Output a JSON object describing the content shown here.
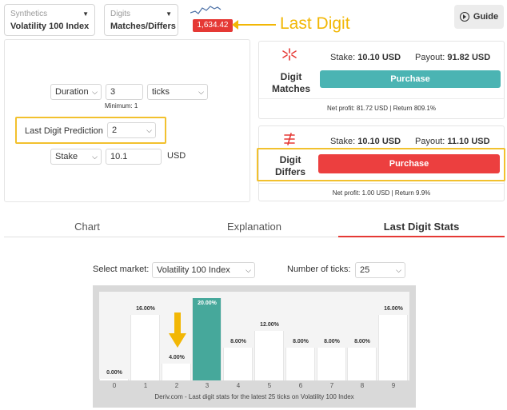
{
  "top": {
    "market_category": "Synthetics",
    "market": "Volatility 100 Index",
    "trade_category": "Digits",
    "trade_type": "Matches/Differs",
    "current_price": "1,634.42",
    "guide_label": "Guide"
  },
  "annotation": {
    "last_digit_label": "Last Digit"
  },
  "params": {
    "duration_label": "Duration",
    "duration_value": "3",
    "duration_unit": "ticks",
    "minimum_note": "Minimum: 1",
    "prediction_label": "Last Digit Prediction",
    "prediction_value": "2",
    "stake_label": "Stake",
    "stake_value": "10.1",
    "currency": "USD"
  },
  "matches": {
    "name_line1": "Digit",
    "name_line2": "Matches",
    "stake_label": "Stake:",
    "stake_value": "10.10 USD",
    "payout_label": "Payout:",
    "payout_value": "91.82 USD",
    "button_label": "Purchase",
    "button_color": "#4bb4b3",
    "footer": "Net profit: 81.72 USD | Return 809.1%"
  },
  "differs": {
    "name_line1": "Digit",
    "name_line2": "Differs",
    "stake_label": "Stake:",
    "stake_value": "10.10 USD",
    "payout_label": "Payout:",
    "payout_value": "11.10 USD",
    "button_label": "Purchase",
    "button_color": "#ec3f3f",
    "footer": "Net profit: 1.00 USD | Return 9.9%"
  },
  "tabs": [
    {
      "label": "Chart",
      "active": false
    },
    {
      "label": "Explanation",
      "active": false
    },
    {
      "label": "Last Digit Stats",
      "active": true
    }
  ],
  "stats": {
    "market_label": "Select market:",
    "market_value": "Volatility 100 Index",
    "ticks_label": "Number of ticks:",
    "ticks_value": "25",
    "caption": "Deriv.com - Last digit stats for the latest 25 ticks on Volatility 100 Index"
  },
  "colors": {
    "accent_red": "#e53935",
    "highlight_yellow": "#f2c12e",
    "bar_active": "#46a89b"
  },
  "chart_data": {
    "type": "bar",
    "categories": [
      "0",
      "1",
      "2",
      "3",
      "4",
      "5",
      "6",
      "7",
      "8",
      "9"
    ],
    "values": [
      0.0,
      16.0,
      4.0,
      20.0,
      8.0,
      12.0,
      8.0,
      8.0,
      8.0,
      16.0
    ],
    "value_labels": [
      "0.00%",
      "16.00%",
      "4.00%",
      "20.00%",
      "8.00%",
      "12.00%",
      "8.00%",
      "8.00%",
      "8.00%",
      "16.00%"
    ],
    "highlighted_category": "3",
    "ylim": [
      0,
      20
    ]
  }
}
